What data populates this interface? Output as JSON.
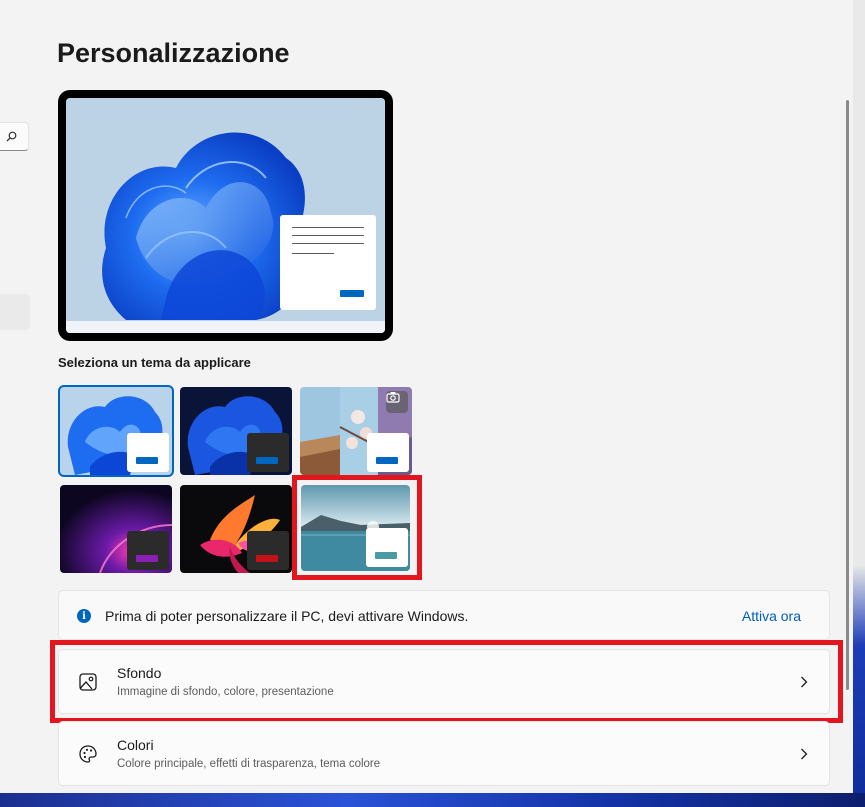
{
  "page": {
    "title": "Personalizzazione"
  },
  "nav": {
    "search_icon": "search-icon"
  },
  "themes": {
    "section_label": "Seleziona un tema da applicare",
    "items": [
      {
        "id": "windows-light",
        "accent": "#0067c0",
        "card": "#ffffff",
        "selected": true
      },
      {
        "id": "windows-dark",
        "accent": "#0067c0",
        "card": "#2b2b2b",
        "selected": false
      },
      {
        "id": "windows-spotlight",
        "accent": "#0067c0",
        "card": "#ffffff",
        "selected": false,
        "badge_icon": "camera-icon"
      },
      {
        "id": "glow",
        "accent": "#8a1fb5",
        "card": "#2b2b2b",
        "selected": false
      },
      {
        "id": "captured-motion",
        "accent": "#c4111a",
        "card": "#2b2b2b",
        "selected": false
      },
      {
        "id": "flow",
        "accent": "#4a9aa6",
        "card": "#ffffff",
        "selected": false
      }
    ]
  },
  "activation": {
    "message": "Prima di poter personalizzare il PC, devi attivare Windows.",
    "link": "Attiva ora",
    "icon": "info-icon"
  },
  "settings": [
    {
      "title": "Sfondo",
      "subtitle": "Immagine di sfondo, colore, presentazione",
      "icon": "image-icon"
    },
    {
      "title": "Colori",
      "subtitle": "Colore principale, effetti di trasparenza, tema colore",
      "icon": "palette-icon"
    }
  ],
  "colors": {
    "accent": "#0067c0",
    "highlight": "#e3161f",
    "link": "#005fb8"
  }
}
